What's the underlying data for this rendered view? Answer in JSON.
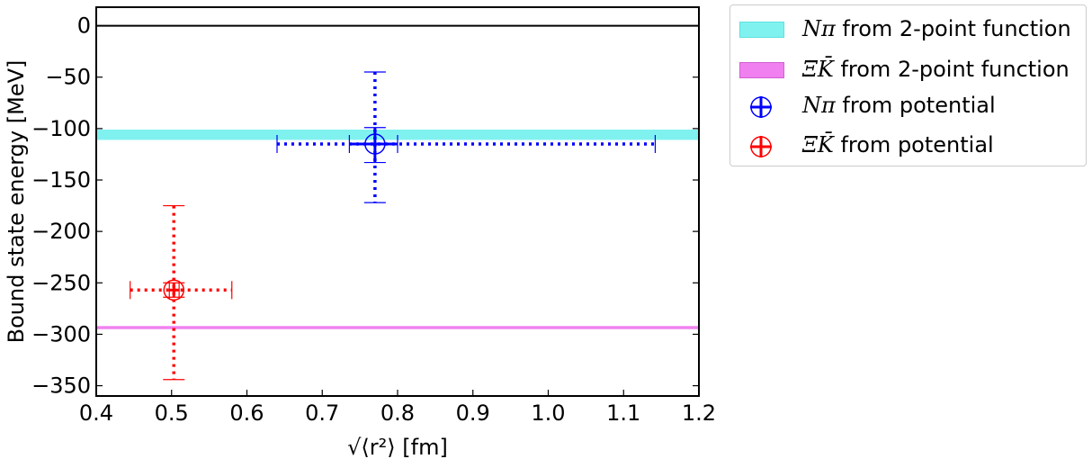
{
  "chart_data": {
    "type": "scatter",
    "title": "",
    "xlabel": "√⟨r²⟩ [fm]",
    "ylabel": "Bound state energy [MeV]",
    "xlim": [
      0.4,
      1.2
    ],
    "ylim": [
      -360,
      18
    ],
    "x_ticks": [
      0.4,
      0.5,
      0.6,
      0.7,
      0.8,
      0.9,
      1.0,
      1.1,
      1.2
    ],
    "x_tick_labels": [
      "0.4",
      "0.5",
      "0.6",
      "0.7",
      "0.8",
      "0.9",
      "1.0",
      "1.1",
      "1.2"
    ],
    "y_ticks": [
      0,
      -50,
      -100,
      -150,
      -200,
      -250,
      -300,
      -350
    ],
    "y_tick_labels": [
      "0",
      "−50",
      "−100",
      "−150",
      "−200",
      "−250",
      "−300",
      "−350"
    ],
    "grid": false,
    "legend_position": "outside-right",
    "reference_line": {
      "y": 0,
      "color": "#000000"
    },
    "bands": [
      {
        "name": "Nπ from 2-point function",
        "y_low": -111,
        "y_high": -101,
        "color": "#7ff2f0"
      },
      {
        "name": "ΞK̄ from 2-point function",
        "y_low": -295,
        "y_high": -292,
        "color": "#f080f0"
      }
    ],
    "series": [
      {
        "name": "Nπ from potential",
        "color": "#0000ff",
        "x": 0.77,
        "y": -115,
        "x_stat_err": [
          0.736,
          0.8
        ],
        "x_sys_err": [
          0.64,
          1.142
        ],
        "y_stat_err": [
          -133,
          -99
        ],
        "y_sys_err": [
          -172,
          -45
        ]
      },
      {
        "name": "ΞK̄ from potential",
        "color": "#ff0000",
        "x": 0.503,
        "y": -257,
        "x_stat_err": [
          0.497,
          0.51
        ],
        "x_sys_err": [
          0.445,
          0.58
        ],
        "y_stat_err": [
          -264,
          -250
        ],
        "y_sys_err": [
          -344,
          -175
        ]
      }
    ]
  },
  "legend": {
    "band1": {
      "sym": "Nπ",
      "text": " from 2-point function"
    },
    "band2": {
      "sym": "ΞK̄",
      "text": " from 2-point function"
    },
    "point1": {
      "sym": "Nπ",
      "text": " from potential"
    },
    "point2": {
      "sym": "ΞK̄",
      "text": " from potential"
    }
  }
}
